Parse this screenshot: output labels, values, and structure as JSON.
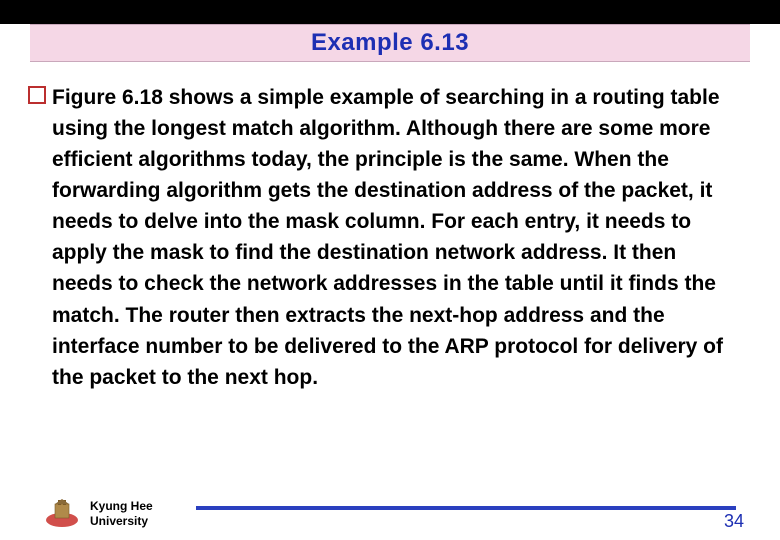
{
  "header": {
    "title": "Example 6.13"
  },
  "content": {
    "paragraph": "Figure 6.18 shows a simple example of searching in a routing table using the longest match algorithm. Although there are some more efficient algorithms today, the principle is the same. When the forwarding algorithm gets the destination address of the packet, it needs to delve into the mask column. For each entry, it needs to apply the mask to find the destination network address. It then needs to check the network addresses in the table until it finds the match. The router then extracts the next-hop address and the interface number to be delivered to the ARP protocol for delivery of the packet to the next hop."
  },
  "footer": {
    "university_line1": "Kyung Hee",
    "university_line2": "University",
    "page_number": "34"
  }
}
